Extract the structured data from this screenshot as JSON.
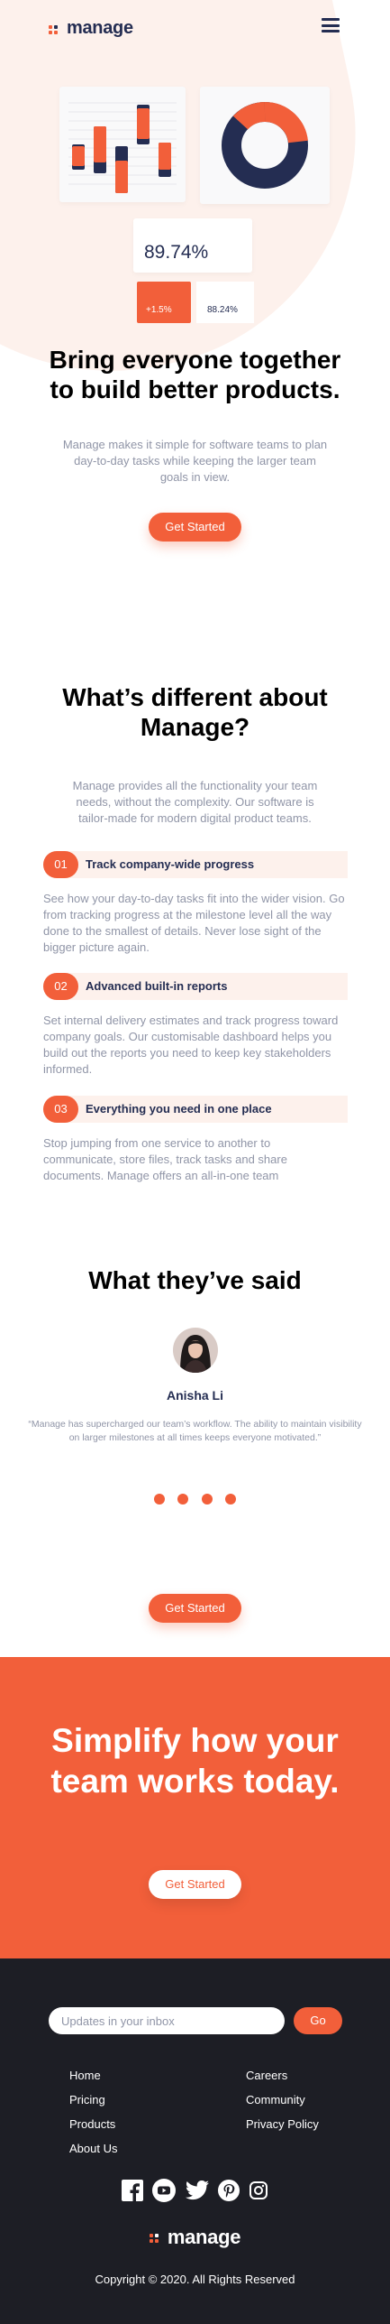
{
  "header": {
    "brand": "manage",
    "menu_icon": "hamburger-icon"
  },
  "hero": {
    "stat_value": "89.74%",
    "stat_change": "+1.5%",
    "stat_secondary": "88.24%",
    "title": "Bring everyone together to build better products.",
    "subtitle": "Manage makes it simple for software teams to plan day-to-day tasks while keeping the larger team goals in view.",
    "cta": "Get Started"
  },
  "different": {
    "title": "What’s different about Manage?",
    "subtitle": "Manage provides all the functionality your team needs, without the complexity. Our software is tailor-made for modern digital product teams.",
    "features": [
      {
        "num": "01",
        "title": "Track company-wide progress",
        "desc": "See how your day-to-day tasks fit into the wider vision. Go from tracking progress at the milestone level all the way done to the smallest of details. Never lose sight of the bigger picture again."
      },
      {
        "num": "02",
        "title": "Advanced built-in reports",
        "desc": "Set internal delivery estimates and track progress toward company goals. Our customisable dashboard helps you build out the reports you need to keep key stakeholders informed."
      },
      {
        "num": "03",
        "title": "Everything you need in one place",
        "desc": "Stop jumping from one service to another to communicate, store files, track tasks and share documents. Manage offers an all-in-one team"
      }
    ]
  },
  "testimonials": {
    "title": "What they’ve said",
    "name": "Anisha Li",
    "quote": "“Manage has supercharged our team’s workflow. The ability to maintain visibility on larger milestones at all times keeps everyone motivated.”",
    "cta": "Get Started"
  },
  "cta_band": {
    "title": "Simplify how your team works today.",
    "cta": "Get Started"
  },
  "footer": {
    "newsletter_placeholder": "Updates in your inbox",
    "go": "Go",
    "links_left": [
      "Home",
      "Pricing",
      "Products",
      "About Us"
    ],
    "links_right": [
      "Careers",
      "Community",
      "Privacy Policy"
    ],
    "socials": [
      "facebook-icon",
      "youtube-icon",
      "twitter-icon",
      "pinterest-icon",
      "instagram-icon"
    ],
    "brand": "manage",
    "copyright": "Copyright © 2020. All Rights Reserved"
  },
  "colors": {
    "accent": "#f25f3a",
    "navy": "#242d52",
    "dark": "#1d1e25",
    "tint": "#fdf1ec"
  }
}
